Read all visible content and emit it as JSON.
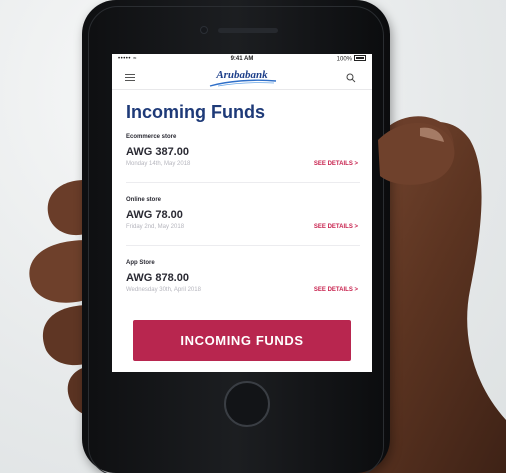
{
  "status_bar": {
    "signal": "••••• ≈",
    "time": "9:41 AM",
    "battery": "100%"
  },
  "app_bar": {
    "logo_text": "Arubabank",
    "menu_icon": "hamburger-icon",
    "search_icon": "search-icon"
  },
  "page": {
    "title": "Incoming Funds"
  },
  "funds": [
    {
      "source": "Ecommerce store",
      "amount": "AWG 387.00",
      "date": "Monday 14th, May 2018",
      "link": "SEE DETAILS >"
    },
    {
      "source": "Online store",
      "amount": "AWG 78.00",
      "date": "Friday 2nd, May 2018",
      "link": "SEE DETAILS >"
    },
    {
      "source": "App Store",
      "amount": "AWG 878.00",
      "date": "Wednesday 30th, April 2018",
      "link": "SEE DETAILS >"
    }
  ],
  "cta": {
    "label": "INCOMING FUNDS"
  },
  "colors": {
    "brand_blue": "#1e3a78",
    "accent_red": "#b8264f",
    "link_red": "#c8234f"
  }
}
